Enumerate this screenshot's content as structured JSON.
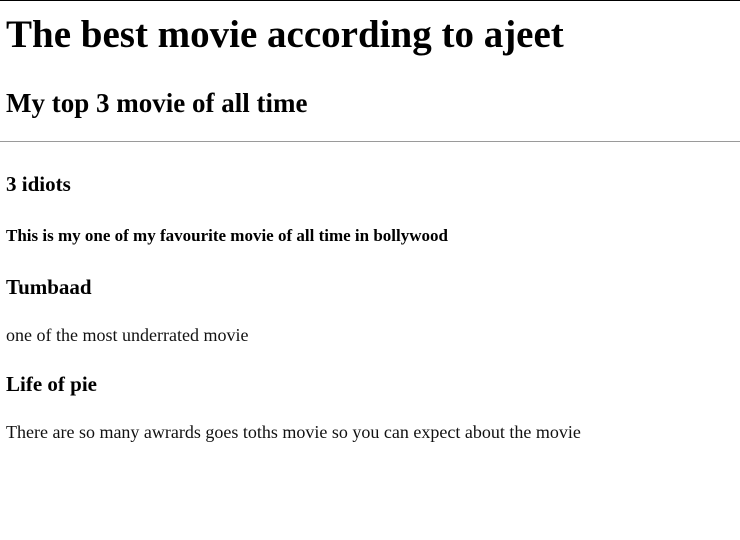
{
  "page": {
    "title": "The best movie according to ajeet",
    "subtitle": "My top 3 movie of all time"
  },
  "movies": [
    {
      "title": "3 idiots",
      "description": "This is my one of my favourite movie of all time in bollywood"
    },
    {
      "title": "Tumbaad",
      "description": "one of the most underrated movie"
    },
    {
      "title": "Life of pie",
      "description": "There are so many awrards goes toths movie so you can expect about the movie"
    }
  ]
}
